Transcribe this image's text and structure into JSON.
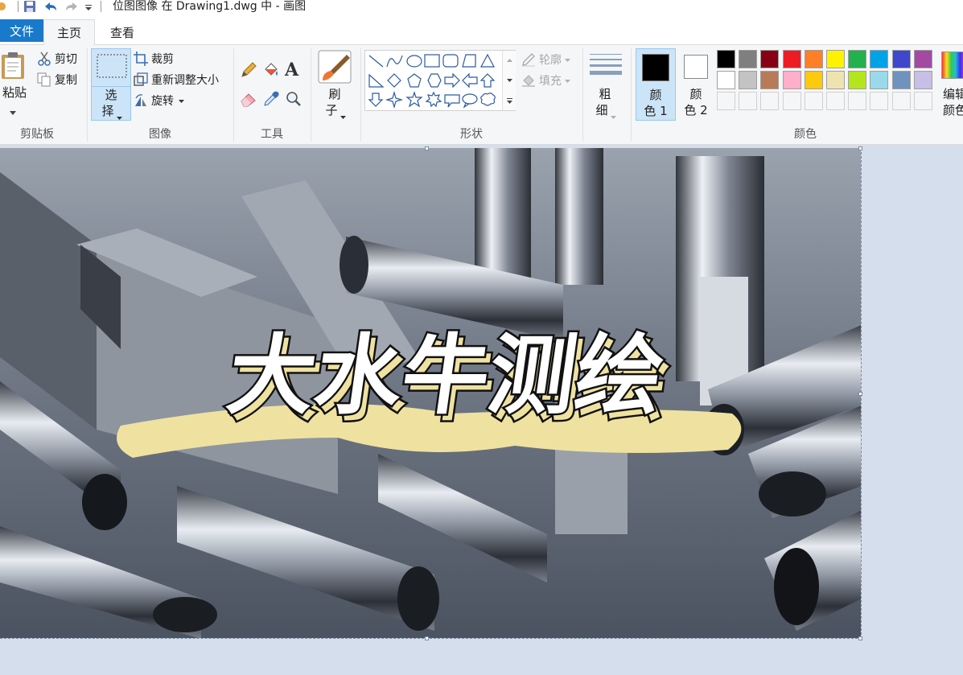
{
  "window": {
    "title": "位图图像 在 Drawing1.dwg 中 - 画图"
  },
  "tabs": {
    "file": "文件",
    "home": "主页",
    "view": "查看"
  },
  "ribbon": {
    "clipboard": {
      "paste": "粘贴",
      "cut": "剪切",
      "copy": "复制",
      "label": "剪贴板"
    },
    "image": {
      "select_line1": "选",
      "select_line2": "择",
      "crop": "裁剪",
      "resize": "重新调整大小",
      "rotate": "旋转",
      "label": "图像"
    },
    "tools": {
      "label": "工具",
      "brush_line1": "刷",
      "brush_line2": "子"
    },
    "shapes": {
      "outline": "轮廓",
      "fill": "填充",
      "label": "形状"
    },
    "size": {
      "line1": "粗",
      "line2": "细"
    },
    "colors": {
      "color1_line1": "颜",
      "color1_line2": "色 1",
      "color2_line1": "颜",
      "color2_line2": "色 2",
      "edit_line1": "编辑",
      "edit_line2": "颜色",
      "label": "颜色",
      "palette_row1": [
        "#000000",
        "#7f7f7f",
        "#880015",
        "#ed1c24",
        "#ff7f27",
        "#fff200",
        "#22b14c",
        "#00a2e8",
        "#3f48cc",
        "#a349a4"
      ],
      "palette_row2": [
        "#ffffff",
        "#c3c3c3",
        "#b97a57",
        "#ffaec9",
        "#ffc90e",
        "#efe4b0",
        "#b5e61d",
        "#99d9ea",
        "#7092be",
        "#c8bfe7"
      ],
      "color1": "#000000",
      "color2": "#ffffff"
    }
  },
  "canvas": {
    "headline": "大水牛测绘",
    "highlight_color": "#efe1a0"
  }
}
